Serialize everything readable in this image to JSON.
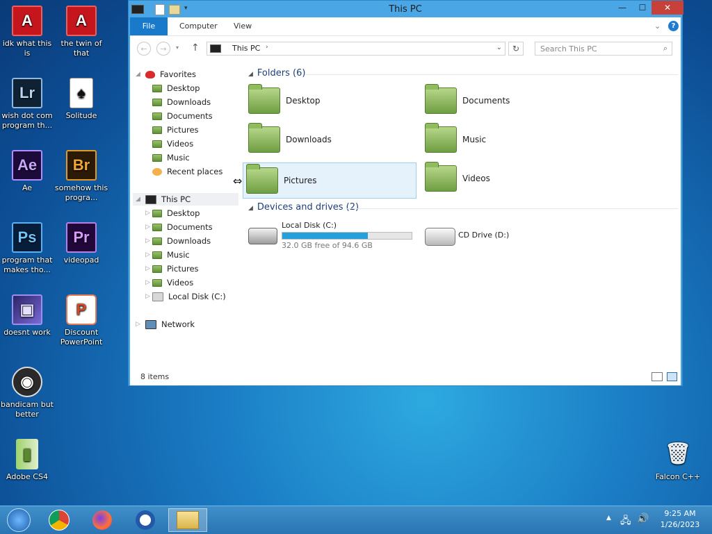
{
  "desktop": {
    "icons": [
      {
        "label": "idk what this is",
        "glyph": "A"
      },
      {
        "label": "the twin of that",
        "glyph": "A"
      },
      {
        "label": "wish dot com program th...",
        "glyph": "Lr"
      },
      {
        "label": "Solitude",
        "glyph": "♠"
      },
      {
        "label": "Ae",
        "glyph": "Ae"
      },
      {
        "label": "somehow this progra...",
        "glyph": "Br"
      },
      {
        "label": "program that makes tho...",
        "glyph": "Ps"
      },
      {
        "label": "videopad",
        "glyph": "Pr"
      },
      {
        "label": "doesnt work",
        "glyph": "▣"
      },
      {
        "label": "Discount PowerPoint",
        "glyph": "P"
      },
      {
        "label": "bandicam but better",
        "glyph": "◉"
      },
      {
        "label": "Adobe CS4",
        "glyph": "▮"
      },
      {
        "label": "Falcon C++",
        "glyph": "🗑"
      }
    ]
  },
  "window": {
    "title": "This PC",
    "controls": {
      "minimize": "—",
      "maximize": "☐",
      "close": "✕"
    },
    "ribbon": {
      "file": "File",
      "computer": "Computer",
      "view": "View"
    },
    "address": {
      "crumb": "This PC",
      "search_placeholder": "Search This PC"
    },
    "nav": {
      "favorites": "Favorites",
      "favorites_items": [
        "Desktop",
        "Downloads",
        "Documents",
        "Pictures",
        "Videos",
        "Music",
        "Recent places"
      ],
      "thispc": "This PC",
      "thispc_items": [
        "Desktop",
        "Documents",
        "Downloads",
        "Music",
        "Pictures",
        "Videos",
        "Local Disk (C:)"
      ],
      "network": "Network"
    },
    "folders_header": "Folders (6)",
    "folders": [
      "Desktop",
      "Documents",
      "Downloads",
      "Music",
      "Pictures",
      "Videos"
    ],
    "devices_header": "Devices and drives (2)",
    "drives": {
      "c_label": "Local Disk (C:)",
      "c_free": "32.0 GB free of 94.6 GB",
      "c_used_fraction": 0.66,
      "d_label": "CD Drive (D:)"
    },
    "status": "8 items"
  },
  "taskbar": {
    "time": "9:25 AM",
    "date": "1/26/2023"
  },
  "colors": {
    "accent": "#1979ca",
    "drive_bar": "#26a0da",
    "selected": "#dcecf8"
  }
}
